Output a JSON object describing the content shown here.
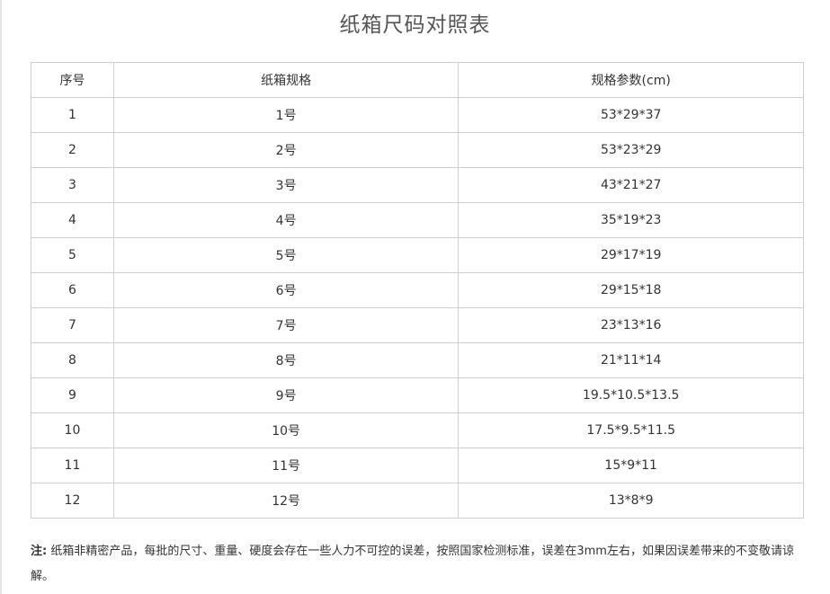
{
  "title": "纸箱尺码对照表",
  "table": {
    "headers": [
      "序号",
      "纸箱规格",
      "规格参数(cm)"
    ],
    "rows": [
      [
        "1",
        "1号",
        "53*29*37"
      ],
      [
        "2",
        "2号",
        "53*23*29"
      ],
      [
        "3",
        "3号",
        "43*21*27"
      ],
      [
        "4",
        "4号",
        "35*19*23"
      ],
      [
        "5",
        "5号",
        "29*17*19"
      ],
      [
        "6",
        "6号",
        "29*15*18"
      ],
      [
        "7",
        "7号",
        "23*13*16"
      ],
      [
        "8",
        "8号",
        "21*11*14"
      ],
      [
        "9",
        "9号",
        "19.5*10.5*13.5"
      ],
      [
        "10",
        "10号",
        "17.5*9.5*11.5"
      ],
      [
        "11",
        "11号",
        "15*9*11"
      ],
      [
        "12",
        "12号",
        "13*8*9"
      ]
    ]
  },
  "note": {
    "label": "注:",
    "text": "纸箱非精密产品，每批的尺寸、重量、硬度会存在一些人力不可控的误差，按照国家检测标准，误差在3mm左右，如果因误差带来的不变敬请谅解。"
  }
}
